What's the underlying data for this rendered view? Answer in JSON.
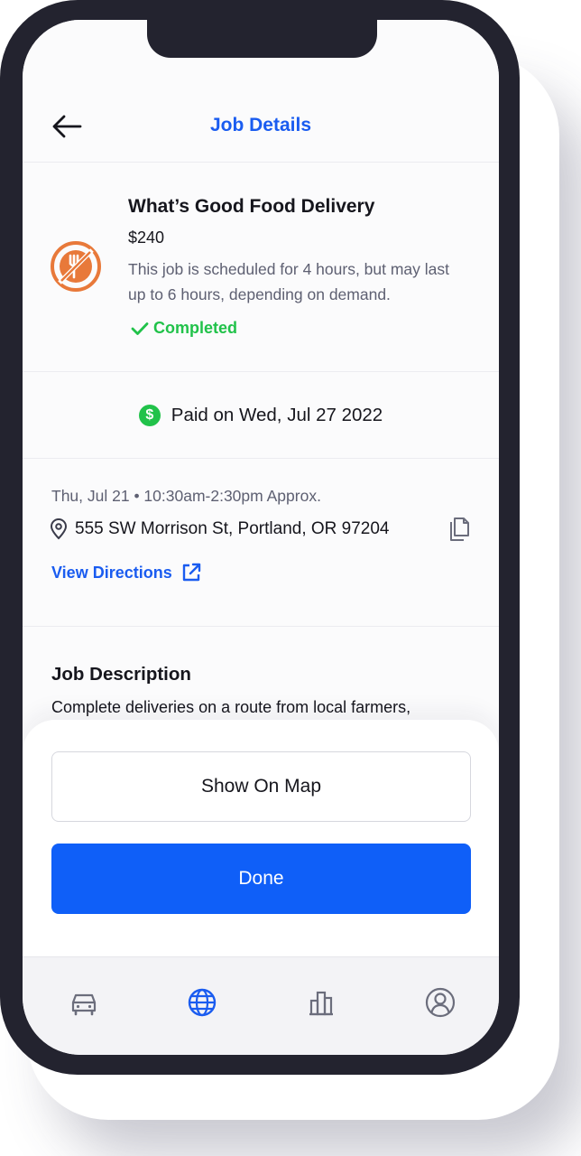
{
  "header": {
    "title": "Job Details",
    "back_icon": "arrow-left-icon"
  },
  "job": {
    "logo_icon": "food-delivery-icon",
    "title": "What’s Good Food Delivery",
    "price": "$240",
    "note": "This job is scheduled for 4 hours, but may last up to 6 hours, depending on demand.",
    "status": "Completed",
    "status_color": "#21c24a"
  },
  "payment": {
    "icon": "dollar-circle-icon",
    "symbol": "$",
    "text": "Paid on Wed, Jul 27 2022"
  },
  "location": {
    "datetime": "Thu, Jul 21 • 10:30am-2:30pm Approx.",
    "address": "555 SW Morrison St, Portland, OR 97204",
    "directions_label": "View Directions"
  },
  "description": {
    "title": "Job Description",
    "text": "Complete deliveries on a route from local farmers,"
  },
  "actions": {
    "show_map_label": "Show On Map",
    "done_label": "Done"
  },
  "tabs": [
    {
      "name": "car-icon",
      "active": false
    },
    {
      "name": "globe-icon",
      "active": true
    },
    {
      "name": "chart-icon",
      "active": false
    },
    {
      "name": "profile-icon",
      "active": false
    }
  ],
  "colors": {
    "accent": "#1a5cf0",
    "primary_button": "#0f5ff8",
    "brand_orange": "#e8793a",
    "success": "#21c24a"
  }
}
